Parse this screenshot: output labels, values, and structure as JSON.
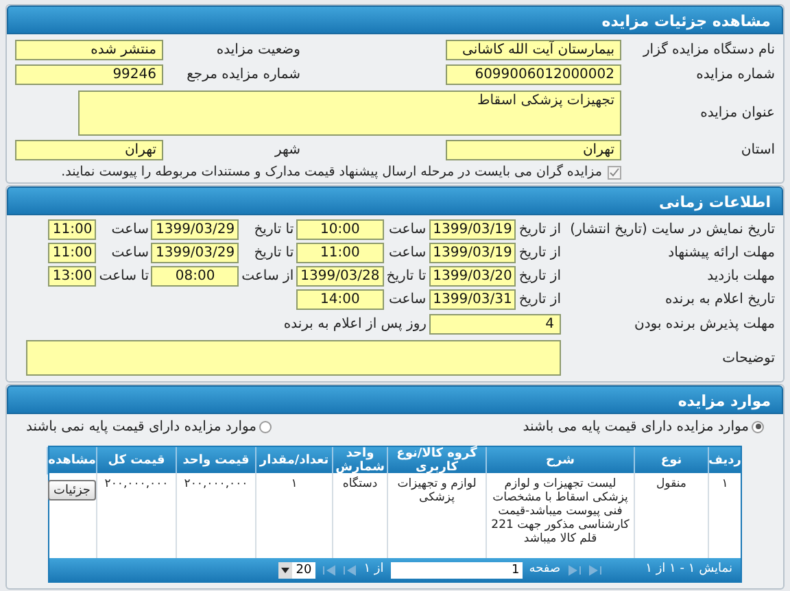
{
  "details": {
    "title": "مشاهده جزئیات مزایده",
    "fields": [
      {
        "label": "نام دستگاه مزایده گزار",
        "value": "بیمارستان آیت الله کاشانی"
      },
      {
        "label": "وضعیت مزایده",
        "value": "منتشر شده"
      },
      {
        "label": "شماره مزایده",
        "value": "6099006012000002"
      },
      {
        "label": "شماره مزایده مرجع",
        "value": "99246"
      }
    ],
    "subject": {
      "label": "عنوان مزایده",
      "value": "تجهیزات پزشکی اسقاط"
    },
    "location": [
      {
        "label": "استان",
        "value": "تهران"
      },
      {
        "label": "شهر",
        "value": "تهران"
      }
    ],
    "documents_notice": {
      "checked": true,
      "text": "مزایده گران می بایست در مرحله ارسال پیشنهاد قیمت مدارک و مستندات مربوطه را پیوست نمایند."
    }
  },
  "timing": {
    "title": "اطلاعات زمانی",
    "rows": [
      {
        "label": "تاریخ نمایش در سایت (تاریخ انتشار)",
        "cells": [
          "از تاریخ",
          "1399/03/19",
          "ساعت",
          "10:00",
          "تا تاریخ",
          "1399/03/29",
          "ساعت",
          "11:00"
        ]
      },
      {
        "label": "مهلت ارائه پیشنهاد",
        "cells": [
          "از تاریخ",
          "1399/03/19",
          "ساعت",
          "11:00",
          "تا تاریخ",
          "1399/03/29",
          "ساعت",
          "11:00"
        ]
      },
      {
        "label": "مهلت بازدید",
        "cells": [
          "از تاریخ",
          "1399/03/20",
          "تا تاریخ",
          "1399/03/28",
          "از ساعت",
          "08:00",
          "تا ساعت",
          "13:00"
        ]
      },
      {
        "label": "تاریخ اعلام به برنده",
        "cells": [
          "از تاریخ",
          "1399/03/31",
          "ساعت",
          "14:00"
        ]
      }
    ],
    "acceptance": {
      "label": "مهلت پذیرش برنده بودن",
      "value": "4",
      "suffix": "روز پس از اعلام به برنده"
    },
    "description": {
      "label": "توضیحات"
    }
  },
  "items": {
    "title": "موارد مزایده",
    "radios": [
      {
        "label": "موارد مزایده دارای قیمت پایه می باشند",
        "selected": true
      },
      {
        "label": "موارد مزایده دارای قیمت پایه نمی باشند",
        "selected": false
      }
    ],
    "table": {
      "columns": [
        "ردیف",
        "نوع",
        "شرح",
        "گروه کالا/نوع کاربری",
        "واحد شمارش",
        "تعداد/مقدار",
        "قیمت واحد",
        "قیمت کل",
        "مشاهده"
      ],
      "rows": [
        {
          "cells": [
            "۱",
            "منقول",
            "لیست تجهیزات و لوازم پزشکی اسقاط با مشخصات فنی پیوست میباشد-قیمت کارشناسی مذکور جهت 221 قلم کالا میباشد",
            "لوازم و تجهیزات پزشکی",
            "دستگاه",
            "۱",
            "۲۰۰,۰۰۰,۰۰۰",
            "۲۰۰,۰۰۰,۰۰۰"
          ],
          "action": "جزئیات"
        }
      ]
    },
    "pager": {
      "summary": "نمایش ۱ - ۱ از ۱",
      "page_label": "صفحه",
      "page": "1",
      "of": "از ۱",
      "page_size": "20"
    }
  }
}
